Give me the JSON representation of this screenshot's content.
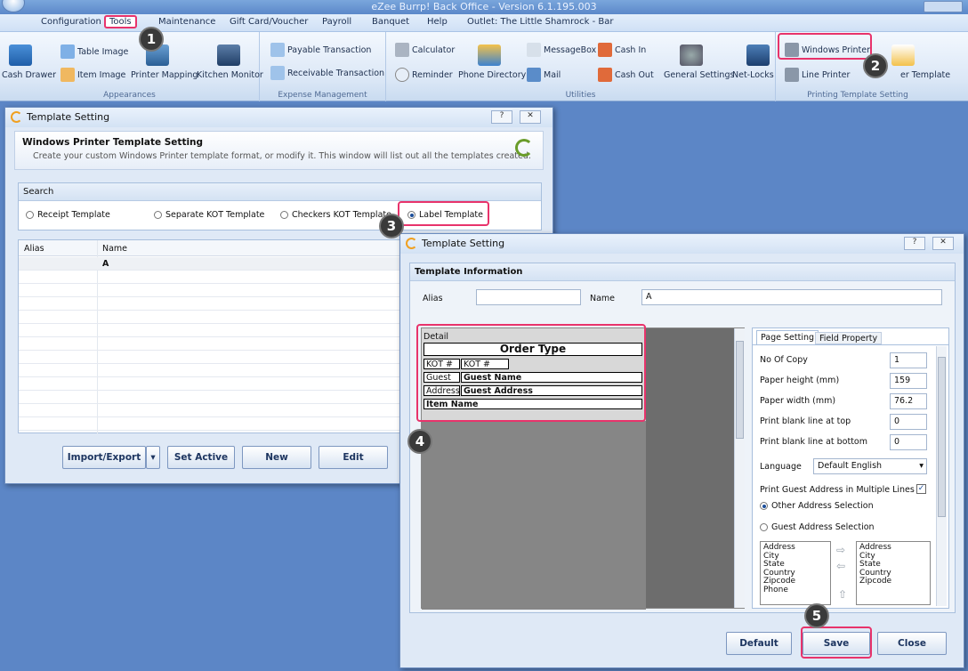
{
  "app": {
    "title": "eZee Burrp! Back Office - Version 6.1.195.003"
  },
  "menu": {
    "items": [
      "Configuration",
      "Tools",
      "Maintenance",
      "Gift Card/Voucher",
      "Payroll",
      "Banquet",
      "Help",
      "Outlet: The Little Shamrock - Bar"
    ]
  },
  "ribbon": {
    "appearances": {
      "label": "Appearances",
      "cash_drawer": "Cash Drawer",
      "table_image": "Table Image",
      "item_image": "Item Image",
      "printer_mapping": "Printer Mapping",
      "kitchen_monitor": "Kitchen Monitor"
    },
    "expense": {
      "label": "Expense Management",
      "payable": "Payable Transaction",
      "receivable": "Receivable Transaction"
    },
    "utilities": {
      "label": "Utilities",
      "calculator": "Calculator",
      "reminder": "Reminder",
      "phone_directory": "Phone Directory",
      "messagebox": "MessageBox",
      "mail": "Mail",
      "cash_in": "Cash In",
      "cash_out": "Cash Out",
      "general_settings": "General Settings",
      "net_locks": "Net-Locks"
    },
    "printing": {
      "label": "Printing Template Setting",
      "windows_printer": "Windows Printer",
      "line_printer": "Line Printer",
      "printer_template": "er Template"
    }
  },
  "badges": [
    "1",
    "2",
    "3",
    "4",
    "5"
  ],
  "dlg1": {
    "title": "Template Setting",
    "heading": "Windows Printer Template Setting",
    "subheading": "Create your custom Windows Printer template format, or modify it. This window will list out all the templates created.",
    "search_label": "Search",
    "radios": [
      "Receipt Template",
      "Separate KOT Template",
      "Checkers KOT Template",
      "Label Template"
    ],
    "selected_radio": "Label Template",
    "columns": [
      "Alias",
      "Name"
    ],
    "rows": [
      {
        "alias": "",
        "name": "A"
      }
    ],
    "buttons": {
      "import_export": "Import/Export",
      "set_active": "Set Active",
      "new": "New",
      "edit": "Edit"
    }
  },
  "dlg2": {
    "title": "Template Setting",
    "section": "Template Information",
    "alias_label": "Alias",
    "alias_value": "",
    "name_label": "Name",
    "name_value": "A",
    "detail": {
      "header": "Detail",
      "order_type": "Order Type",
      "kot_label": "KOT #",
      "kot_value": "KOT #",
      "guest_label": "Guest",
      "guest_value": "Guest Name",
      "address_label": "Address",
      "address_value": "Guest Address",
      "item_name": "Item Name"
    },
    "tabs": [
      "Page Setting",
      "Field Property"
    ],
    "page_setting": {
      "no_of_copy_label": "No Of Copy",
      "no_of_copy": "1",
      "paper_height_label": "Paper height (mm)",
      "paper_height": "159",
      "paper_width_label": "Paper width (mm)",
      "paper_width": "76.2",
      "blank_top_label": "Print blank line at top",
      "blank_top": "0",
      "blank_bottom_label": "Print blank line at bottom",
      "blank_bottom": "0",
      "language_label": "Language",
      "language": "Default English",
      "multi_line_label": "Print Guest Address in Multiple Lines",
      "other_addr": "Other Address Selection",
      "guest_addr": "Guest Address Selection",
      "left_list": [
        "Address",
        "City",
        "State",
        "Country",
        "Zipcode",
        "Phone"
      ],
      "right_list": [
        "Address",
        "City",
        "State",
        "Country",
        "Zipcode"
      ]
    },
    "buttons": {
      "default": "Default",
      "save": "Save",
      "close": "Close"
    }
  },
  "colors": {
    "highlight": "#e8336b",
    "badge": "#3a3a3a"
  }
}
